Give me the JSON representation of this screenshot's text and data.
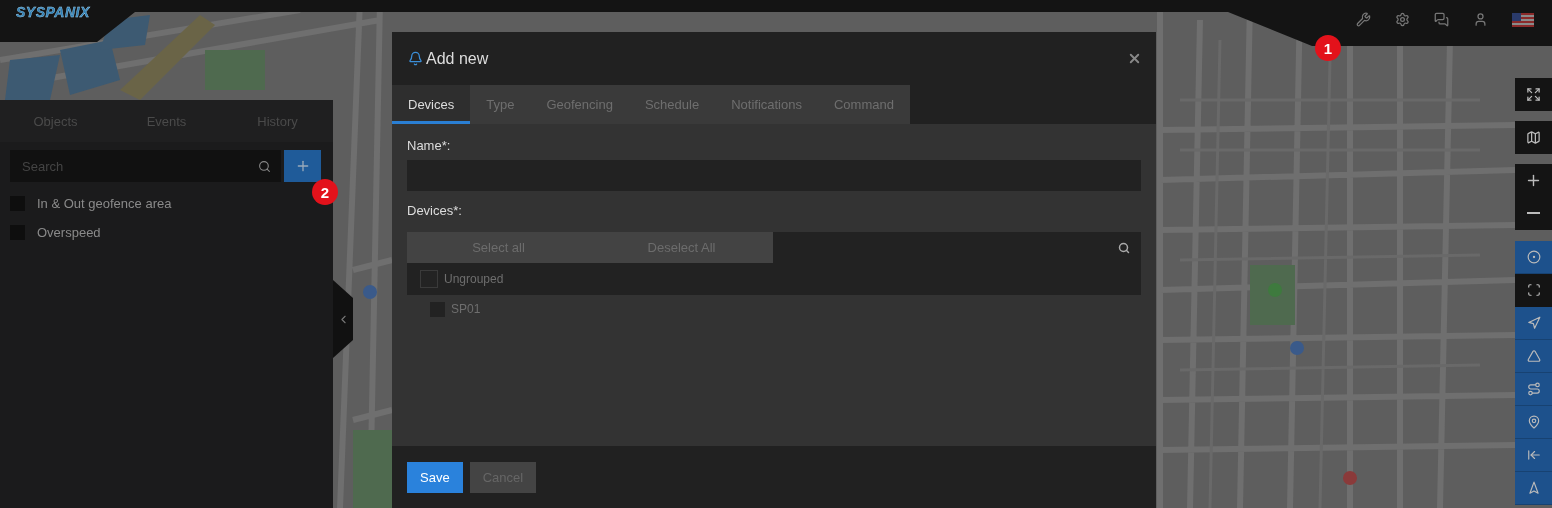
{
  "top_bar": {
    "logo": "SYSPANIX"
  },
  "annotations": [
    {
      "label": "1"
    },
    {
      "label": "2"
    }
  ],
  "sidebar": {
    "tabs": [
      {
        "label": "Objects",
        "selected": false
      },
      {
        "label": "Events",
        "selected": false
      },
      {
        "label": "History",
        "selected": false
      }
    ],
    "search": {
      "placeholder": "Search"
    },
    "items": [
      {
        "label": "In & Out geofence area",
        "checked": false
      },
      {
        "label": "Overspeed",
        "checked": false
      }
    ]
  },
  "modal": {
    "title": "Add new",
    "tabs": [
      {
        "label": "Devices",
        "selected": true
      },
      {
        "label": "Type",
        "selected": false
      },
      {
        "label": "Geofencing",
        "selected": false
      },
      {
        "label": "Schedule",
        "selected": false
      },
      {
        "label": "Notifications",
        "selected": false
      },
      {
        "label": "Command",
        "selected": false
      }
    ],
    "name_label": "Name*:",
    "devices_label": "Devices*:",
    "select_all": "Select all",
    "deselect_all": "Deselect All",
    "groups": [
      {
        "label": "Ungrouped",
        "checked": false,
        "children": [
          {
            "label": "SP01",
            "checked": false
          }
        ]
      }
    ],
    "buttons": [
      {
        "label": "Save",
        "kind": "primary"
      },
      {
        "label": "Cancel",
        "kind": "secondary"
      }
    ]
  },
  "map_tools": [
    {
      "on": true
    },
    {
      "on": false
    },
    {
      "on": true
    },
    {
      "on": true
    },
    {
      "on": true
    },
    {
      "on": true
    },
    {
      "on": true
    },
    {
      "on": true
    }
  ]
}
